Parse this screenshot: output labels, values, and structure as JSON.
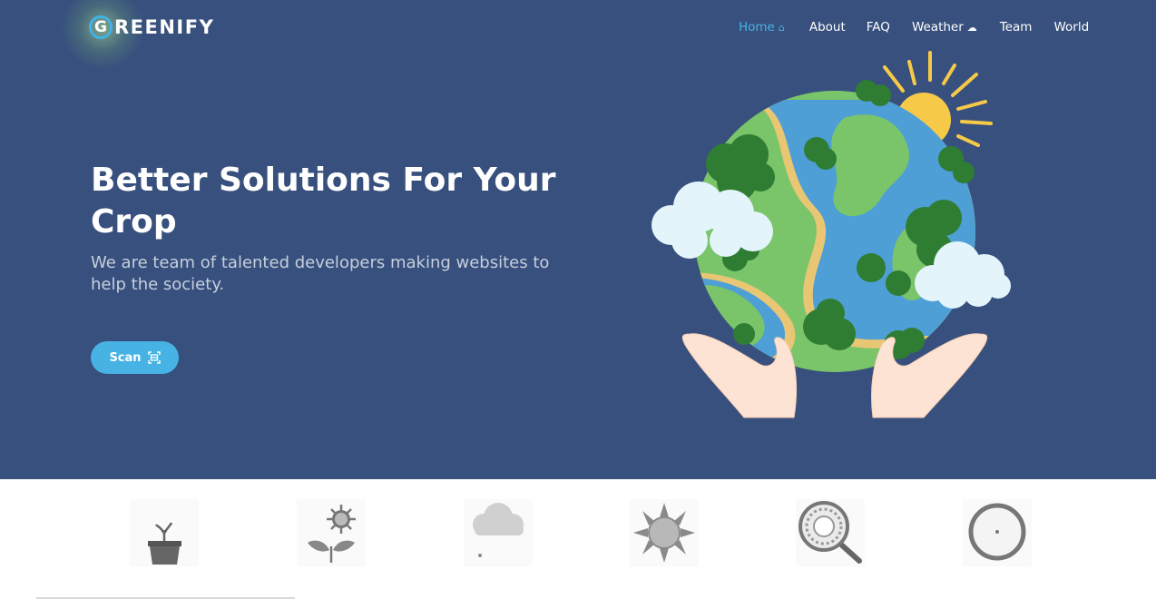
{
  "brand": {
    "logo_letter": "G",
    "logo_text": "REENIFY"
  },
  "nav": {
    "items": [
      {
        "label": "Home",
        "icon": "home-icon",
        "active": true
      },
      {
        "label": "About"
      },
      {
        "label": "FAQ"
      },
      {
        "label": "Weather",
        "icon": "weather-icon"
      },
      {
        "label": "Team"
      },
      {
        "label": "World"
      }
    ]
  },
  "hero": {
    "headline": "Better Solutions For Your Crop",
    "subtext": "We are team of talented developers making websites to help the society.",
    "scan_button": "Scan",
    "scan_icon": "scan-icon",
    "illustration": "earth-in-hands-illustration"
  },
  "features": [
    {
      "icon": "plant-pot-icon"
    },
    {
      "icon": "flower-sun-icon"
    },
    {
      "icon": "rain-cloud-icon"
    },
    {
      "icon": "sun-icon"
    },
    {
      "icon": "magnifier-icon"
    },
    {
      "icon": "ring-icon"
    }
  ],
  "colors": {
    "hero_bg": "#37507d",
    "accent": "#47b2e4",
    "white": "#ffffff"
  }
}
